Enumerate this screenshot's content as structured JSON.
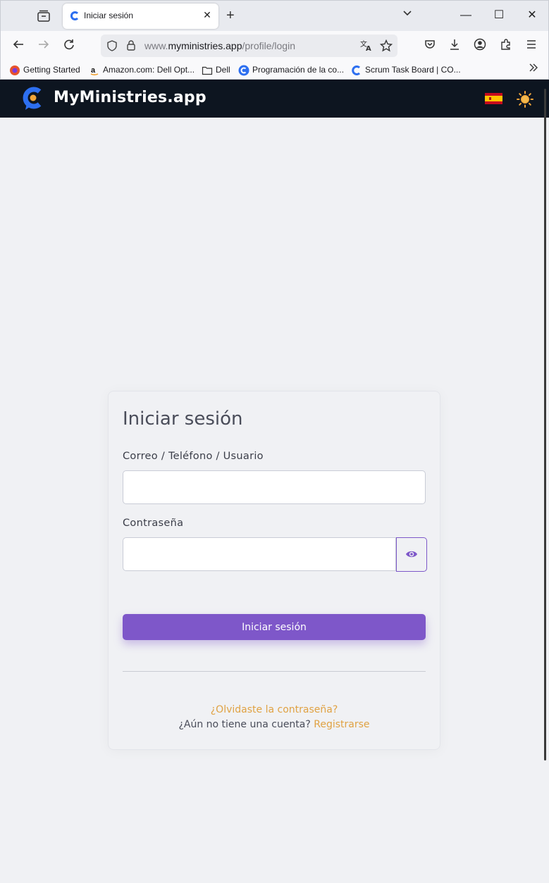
{
  "browser": {
    "tab_title": "Iniciar sesión",
    "tab_close": "✕",
    "new_tab": "+",
    "url_host": "www.myministries.app",
    "url_path": "/profile/login",
    "url_host_domain": "myministries.app",
    "url_prefix": "www.",
    "window_controls": [
      "—",
      "☐",
      "✕"
    ],
    "bookmarks": [
      {
        "label": "Getting Started",
        "icon": "firefox-icon"
      },
      {
        "label": "Amazon.com: Dell Opt...",
        "icon": "amazon-icon"
      },
      {
        "label": "Dell",
        "icon": "folder-icon"
      },
      {
        "label": "Programación de la co...",
        "icon": "myministries-icon"
      },
      {
        "label": "Scrum Task Board | CO...",
        "icon": "myministries-icon"
      }
    ]
  },
  "app": {
    "brand": "MyMinistries.app",
    "language_flag": "es",
    "accent_color": "#7e57c9",
    "link_color": "#e0a243",
    "header_bg": "#0d1520"
  },
  "login": {
    "title": "Iniciar sesión",
    "username_label": "Correo / Teléfono / Usuario",
    "username_value": "",
    "password_label": "Contraseña",
    "password_value": "",
    "submit_label": "Iniciar sesión",
    "forgot_label": "¿Olvidaste la contraseña?",
    "no_account_text": "¿Aún no tiene una cuenta?",
    "register_label": "Registrarse"
  }
}
